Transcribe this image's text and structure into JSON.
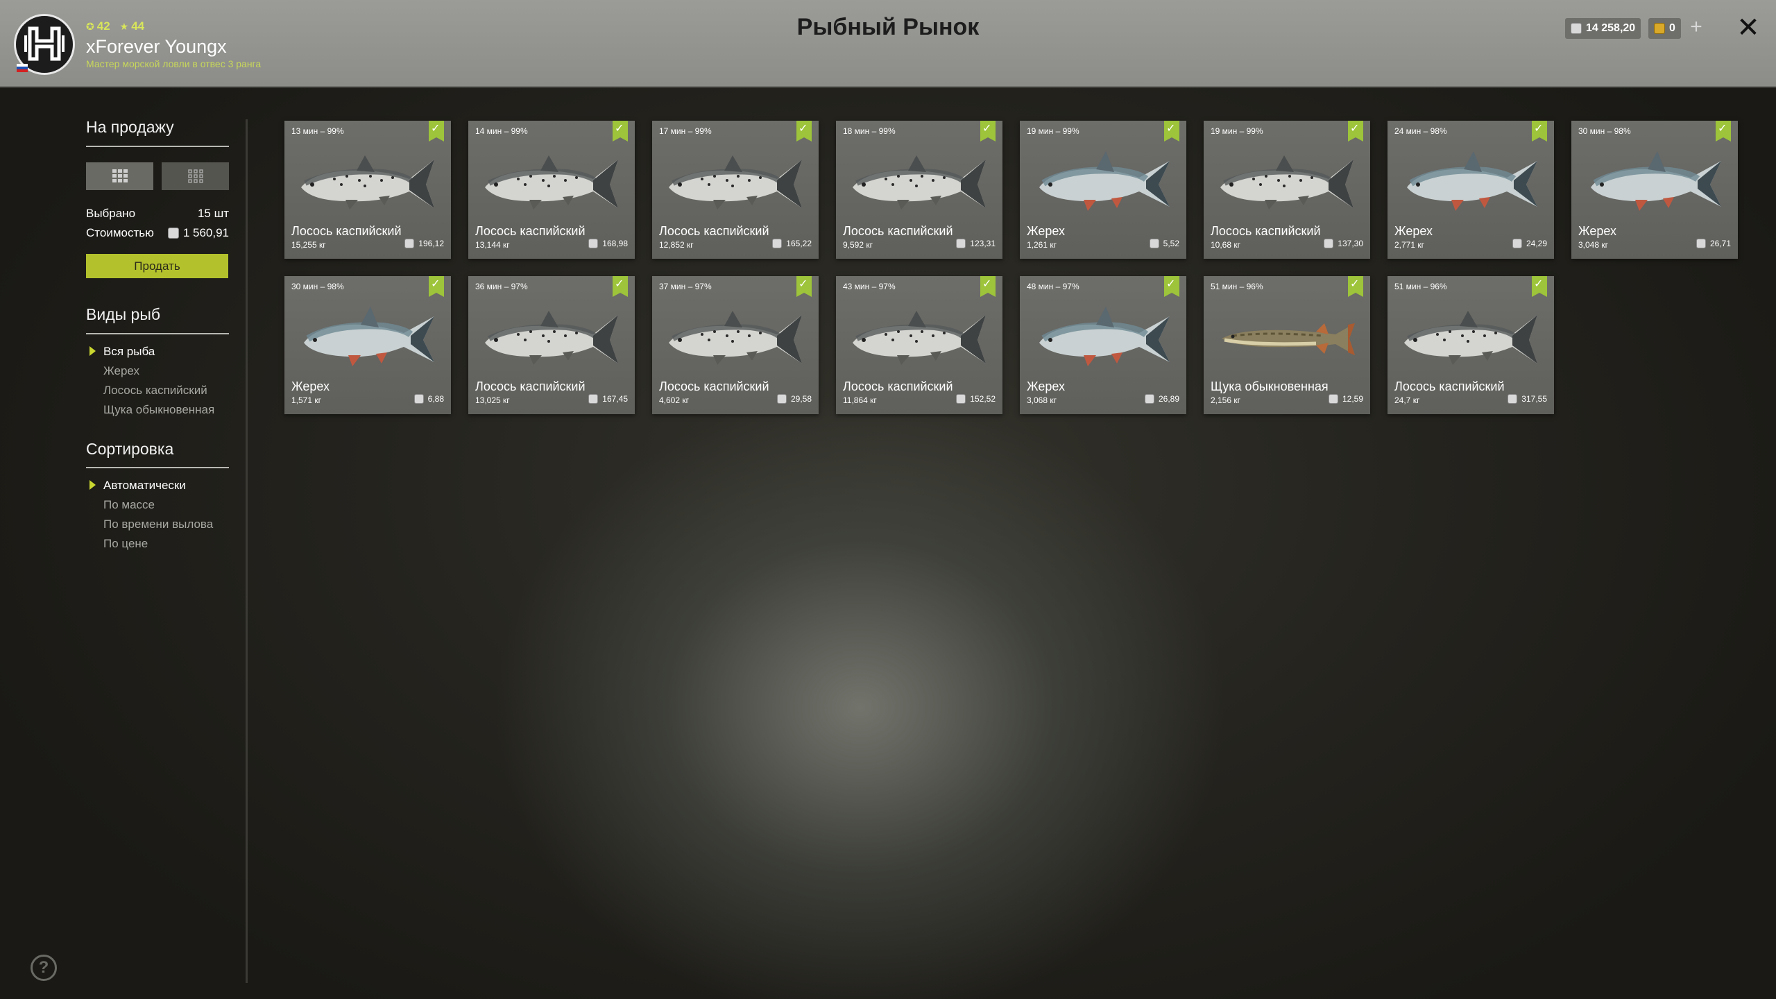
{
  "header": {
    "title": "Рыбный Рынок",
    "player": {
      "level": "42",
      "rank_level": "44",
      "name": "xForever Youngx",
      "rank_title": "Мастер морской ловли в отвес 3 ранга"
    },
    "silver": "14 258,20",
    "gold": "0"
  },
  "sidebar": {
    "for_sale_title": "На продажу",
    "selected_label": "Выбрано",
    "selected_value": "15 шт",
    "cost_label": "Стоимостью",
    "cost_value": "1 560,91",
    "sell_label": "Продать",
    "species_title": "Виды рыб",
    "species": [
      "Вся рыба",
      "Жерех",
      "Лосось каспийский",
      "Щука обыкновенная"
    ],
    "species_selected": 0,
    "sort_title": "Сортировка",
    "sort_options": [
      "Автоматически",
      "По массе",
      "По времени вылова",
      "По цене"
    ],
    "sort_selected": 0
  },
  "fish": [
    {
      "time": "13 мин – 99%",
      "name": "Лосось каспийский",
      "weight": "15,255 кг",
      "price": "196,12",
      "kind": "salmon"
    },
    {
      "time": "14 мин – 99%",
      "name": "Лосось каспийский",
      "weight": "13,144 кг",
      "price": "168,98",
      "kind": "salmon"
    },
    {
      "time": "17 мин – 99%",
      "name": "Лосось каспийский",
      "weight": "12,852 кг",
      "price": "165,22",
      "kind": "salmon"
    },
    {
      "time": "18 мин – 99%",
      "name": "Лосось каспийский",
      "weight": "9,592 кг",
      "price": "123,31",
      "kind": "salmon"
    },
    {
      "time": "19 мин – 99%",
      "name": "Жерех",
      "weight": "1,261 кг",
      "price": "5,52",
      "kind": "asp"
    },
    {
      "time": "19 мин – 99%",
      "name": "Лосось каспийский",
      "weight": "10,68 кг",
      "price": "137,30",
      "kind": "salmon"
    },
    {
      "time": "24 мин – 98%",
      "name": "Жерех",
      "weight": "2,771 кг",
      "price": "24,29",
      "kind": "asp"
    },
    {
      "time": "30 мин – 98%",
      "name": "Жерех",
      "weight": "3,048 кг",
      "price": "26,71",
      "kind": "asp"
    },
    {
      "time": "30 мин – 98%",
      "name": "Жерех",
      "weight": "1,571 кг",
      "price": "6,88",
      "kind": "asp"
    },
    {
      "time": "36 мин – 97%",
      "name": "Лосось каспийский",
      "weight": "13,025 кг",
      "price": "167,45",
      "kind": "salmon"
    },
    {
      "time": "37 мин – 97%",
      "name": "Лосось каспийский",
      "weight": "4,602 кг",
      "price": "29,58",
      "kind": "salmon"
    },
    {
      "time": "43 мин – 97%",
      "name": "Лосось каспийский",
      "weight": "11,864 кг",
      "price": "152,52",
      "kind": "salmon"
    },
    {
      "time": "48 мин – 97%",
      "name": "Жерех",
      "weight": "3,068 кг",
      "price": "26,89",
      "kind": "asp"
    },
    {
      "time": "51 мин – 96%",
      "name": "Щука обыкновенная",
      "weight": "2,156 кг",
      "price": "12,59",
      "kind": "pike"
    },
    {
      "time": "51 мин – 96%",
      "name": "Лосось каспийский",
      "weight": "24,7 кг",
      "price": "317,55",
      "kind": "salmon"
    }
  ],
  "colors": {
    "accent": "#b3c12c",
    "check": "#9dc43a",
    "card": "#666662"
  }
}
